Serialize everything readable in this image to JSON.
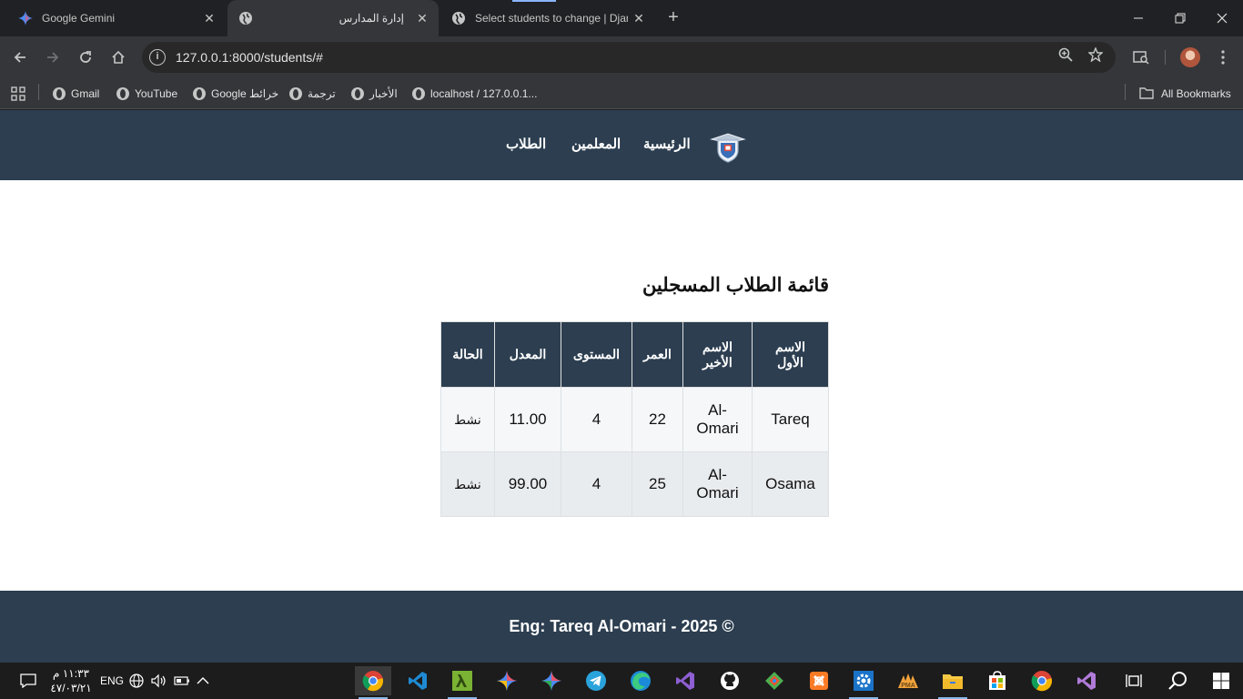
{
  "browser": {
    "tabs": [
      {
        "title": "Google Gemini",
        "icon": "gemini-icon"
      },
      {
        "title": "إدارة المدارس",
        "icon": "globe-icon"
      },
      {
        "title": "Select students to change | Djan",
        "icon": "globe-icon"
      }
    ],
    "url": "127.0.0.1:8000/students/#",
    "bookmarks": [
      {
        "label": "Gmail"
      },
      {
        "label": "YouTube"
      },
      {
        "label": "Google خرائط"
      },
      {
        "label": "ترجمة"
      },
      {
        "label": "الأخبار"
      },
      {
        "label": "localhost / 127.0.0.1..."
      }
    ],
    "all_bookmarks": "All Bookmarks"
  },
  "nav": {
    "home": "الرئيسية",
    "teachers": "المعلمين",
    "students": "الطلاب"
  },
  "main": {
    "heading": "قائمة الطلاب المسجلين",
    "table": {
      "headers": [
        "الاسم الأول",
        "الاسم الأخير",
        "العمر",
        "المستوى",
        "المعدل",
        "الحالة"
      ],
      "rows": [
        [
          "Tareq",
          "Al-Omari",
          "22",
          "4",
          "11.00",
          "نشط"
        ],
        [
          "Osama",
          "Al-Omari",
          "25",
          "4",
          "99.00",
          "نشط"
        ]
      ]
    }
  },
  "footer": {
    "text": "Eng: Tareq Al-Omari - 2025 ©"
  },
  "taskbar": {
    "time": "١١:٣٣ م",
    "date": "٤٧/٠٣/٢١",
    "language": "ENG"
  },
  "colors": {
    "navbar": "#2c3e50",
    "table_header": "#2c3e50",
    "footer": "#2c3e50",
    "page_bg": "#ffffff"
  }
}
